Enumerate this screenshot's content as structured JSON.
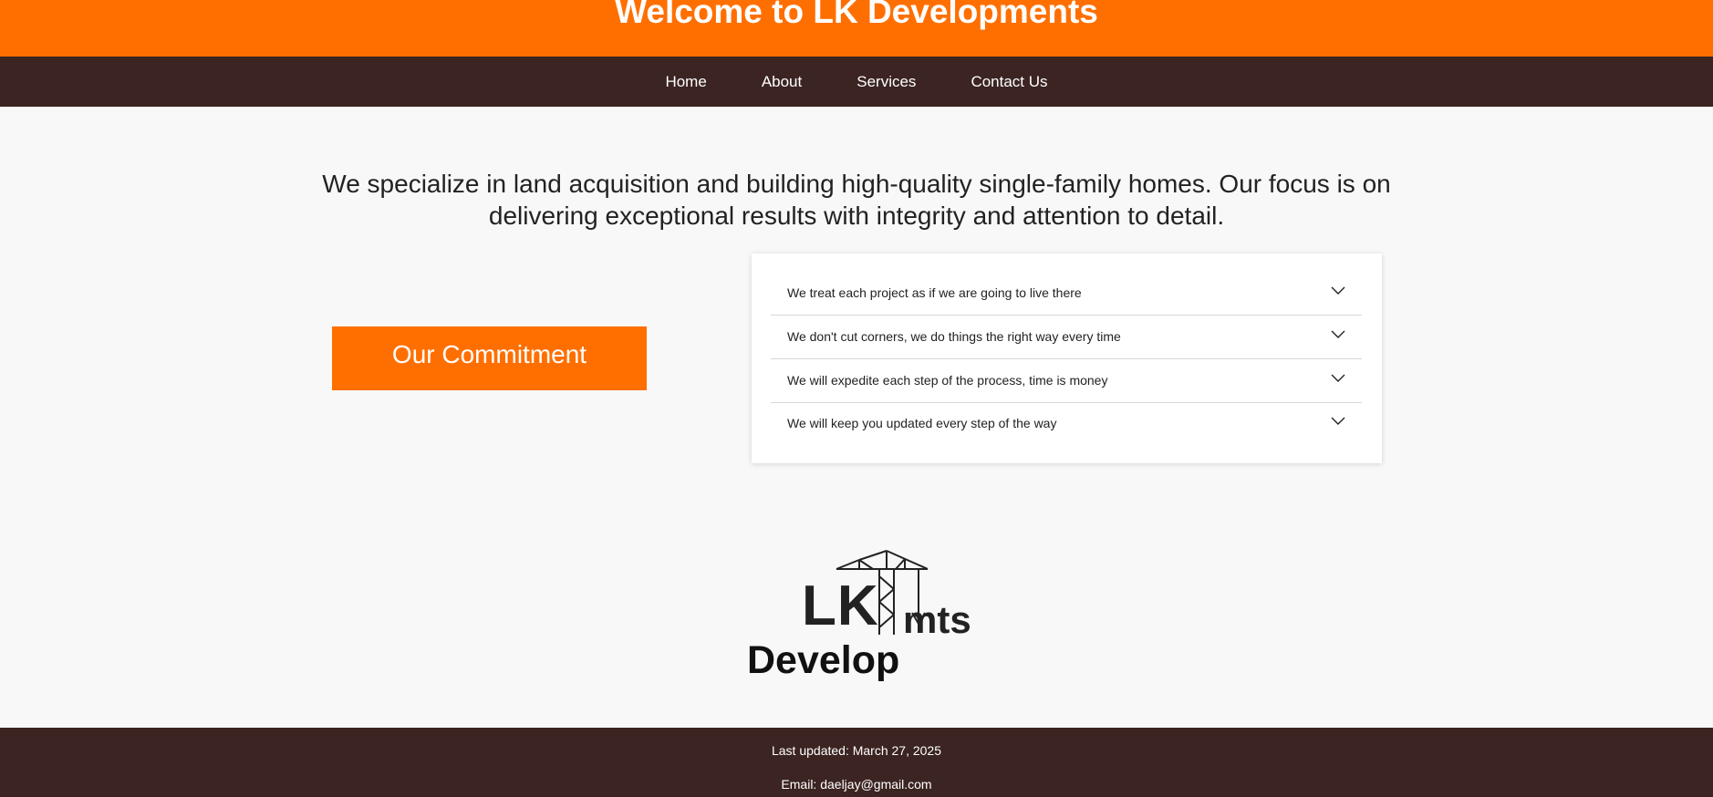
{
  "header": {
    "title": "Welcome to LK Developments"
  },
  "nav": {
    "items": [
      {
        "label": "Home"
      },
      {
        "label": "About"
      },
      {
        "label": "Services"
      },
      {
        "label": "Contact Us"
      }
    ]
  },
  "intro": {
    "text": "We specialize in land acquisition and building high-quality single-family homes. Our focus is on delivering exceptional results with integrity and attention to detail."
  },
  "commitment": {
    "label": "Our Commitment"
  },
  "accordion": {
    "items": [
      {
        "label": "We treat each project as if we are going to live there",
        "icon": "chevron-down-icon"
      },
      {
        "label": "We don't cut corners, we do things the right way every time",
        "icon": "chevron-down-icon"
      },
      {
        "label": "We will expedite each step of the process, time is money",
        "icon": "chevron-down-icon"
      },
      {
        "label": "We will keep you updated every step of the way",
        "icon": "chevron-down-icon"
      }
    ]
  },
  "logo": {
    "text_lk": "LK",
    "text_mts": "mts",
    "text_develop": "Develop",
    "icon": "crane-icon"
  },
  "footer": {
    "last_updated": "Last updated: March 27, 2025",
    "email": "Email: daeljay@gmail.com"
  },
  "colors": {
    "accent": "#ff6f00",
    "dark_brown": "#3b2421",
    "background": "#f8f8f8"
  }
}
